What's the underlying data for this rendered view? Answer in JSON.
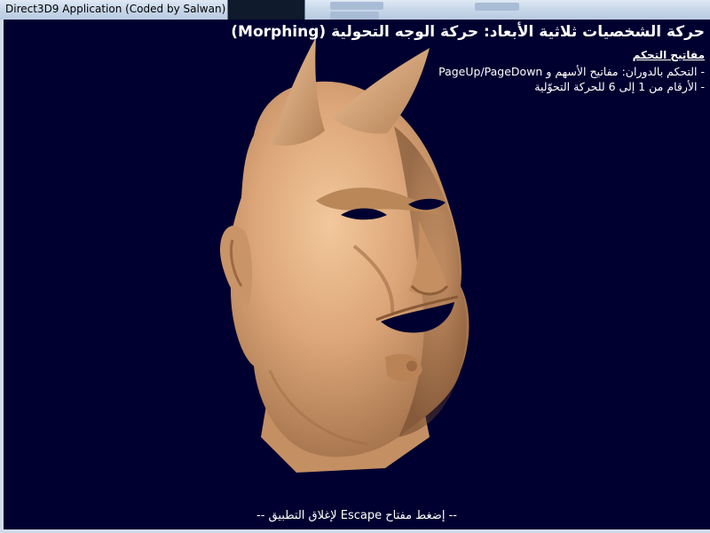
{
  "window": {
    "title": "Direct3D9 Application (Coded by Salwan)"
  },
  "overlay": {
    "heading": "حركة الشخصيات ثلاثية الأبعاد: حركة الوجه التحولية (Morphing)",
    "controls_title": "مفاتيح التحكم",
    "controls": [
      "- التحكم بالدوران: مفاتيح الأسهم و PageUp/PageDown",
      "- الأرقام من 1 إلى 6 للحركة التحوّلية"
    ],
    "footer": "-- إضغط مفتاح Escape لإغلاق التطبيق --"
  },
  "scene": {
    "object": "3d-devil-head-icon",
    "skin_color": "#d9a67a",
    "background_color": "#000030"
  }
}
